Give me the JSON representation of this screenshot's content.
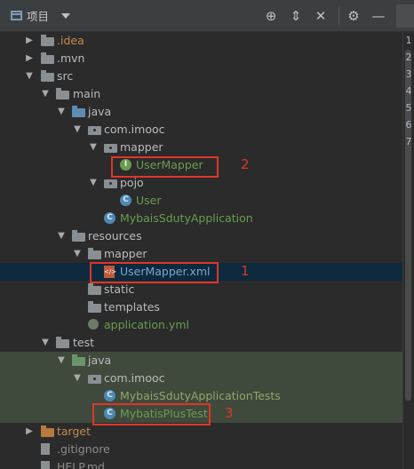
{
  "toolbar": {
    "title": "项目",
    "icons": [
      "globe-icon",
      "collapse-all-icon",
      "close-icon",
      "gear-icon"
    ]
  },
  "tree": [
    {
      "label": ".idea",
      "depth": 1,
      "expanded": false,
      "icon": "folder",
      "color": "#c38b4e"
    },
    {
      "label": ".mvn",
      "depth": 1,
      "expanded": false,
      "icon": "folder",
      "color": "#bbbbbb"
    },
    {
      "label": "src",
      "depth": 1,
      "expanded": true,
      "icon": "folder",
      "color": "#bbbbbb"
    },
    {
      "label": "main",
      "depth": 2,
      "expanded": true,
      "icon": "folder",
      "color": "#bbbbbb"
    },
    {
      "label": "java",
      "depth": 3,
      "expanded": true,
      "icon": "folder-blue",
      "color": "#bbbbbb"
    },
    {
      "label": "com.imooc",
      "depth": 4,
      "expanded": true,
      "icon": "package",
      "color": "#bbbbbb"
    },
    {
      "label": "mapper",
      "depth": 5,
      "expanded": true,
      "icon": "package",
      "color": "#bbbbbb"
    },
    {
      "label": "UserMapper",
      "depth": 6,
      "icon": "interface",
      "color": "#6a9b50"
    },
    {
      "label": "pojo",
      "depth": 5,
      "expanded": true,
      "icon": "package",
      "color": "#bbbbbb"
    },
    {
      "label": "User",
      "depth": 6,
      "icon": "class",
      "color": "#6a9b50"
    },
    {
      "label": "MybaisSdutyApplication",
      "depth": 5,
      "icon": "spring-class",
      "color": "#6a9b50"
    },
    {
      "label": "resources",
      "depth": 3,
      "expanded": true,
      "icon": "folder-res",
      "color": "#bbbbbb"
    },
    {
      "label": "mapper",
      "depth": 4,
      "expanded": true,
      "icon": "folder",
      "color": "#bbbbbb"
    },
    {
      "label": "UserMapper.xml",
      "depth": 5,
      "icon": "xml",
      "color": "#79a6cf"
    },
    {
      "label": "static",
      "depth": 4,
      "icon": "folder",
      "color": "#bbbbbb"
    },
    {
      "label": "templates",
      "depth": 4,
      "icon": "folder",
      "color": "#bbbbbb"
    },
    {
      "label": "application.yml",
      "depth": 4,
      "icon": "yml",
      "color": "#6a9b50"
    },
    {
      "label": "test",
      "depth": 2,
      "expanded": true,
      "icon": "folder",
      "color": "#bbbbbb"
    },
    {
      "label": "java",
      "depth": 3,
      "expanded": true,
      "icon": "folder-green",
      "color": "#bbbbbb"
    },
    {
      "label": "com.imooc",
      "depth": 4,
      "expanded": true,
      "icon": "package",
      "color": "#bbbbbb"
    },
    {
      "label": "MybaisSdutyApplicationTests",
      "depth": 5,
      "icon": "spring-class",
      "color": "#6a9b50"
    },
    {
      "label": "MybatisPlusTest",
      "depth": 5,
      "icon": "spring-class",
      "color": "#6a9b50"
    },
    {
      "label": "target",
      "depth": 1,
      "expanded": false,
      "icon": "folder-orange",
      "color": "#c38b4e"
    },
    {
      "label": ".gitignore",
      "depth": 1,
      "icon": "file",
      "color": "#8c8c8c"
    },
    {
      "label": "HELP.md",
      "depth": 1,
      "icon": "file",
      "color": "#8c8c8c"
    }
  ],
  "annotations": [
    {
      "number": "1",
      "target": "UserMapper.xml"
    },
    {
      "number": "2",
      "target": "UserMapper"
    },
    {
      "number": "3",
      "target": "MybatisPlusTest"
    }
  ],
  "gutter_numbers": [
    "1",
    "2",
    "3",
    "4",
    "5",
    "6",
    "7"
  ],
  "colors": {
    "background": "#2b2b2b",
    "selected_row": "#0d293e",
    "test_rows": "#3f4a3c",
    "annotation_red": "#e0352a"
  }
}
